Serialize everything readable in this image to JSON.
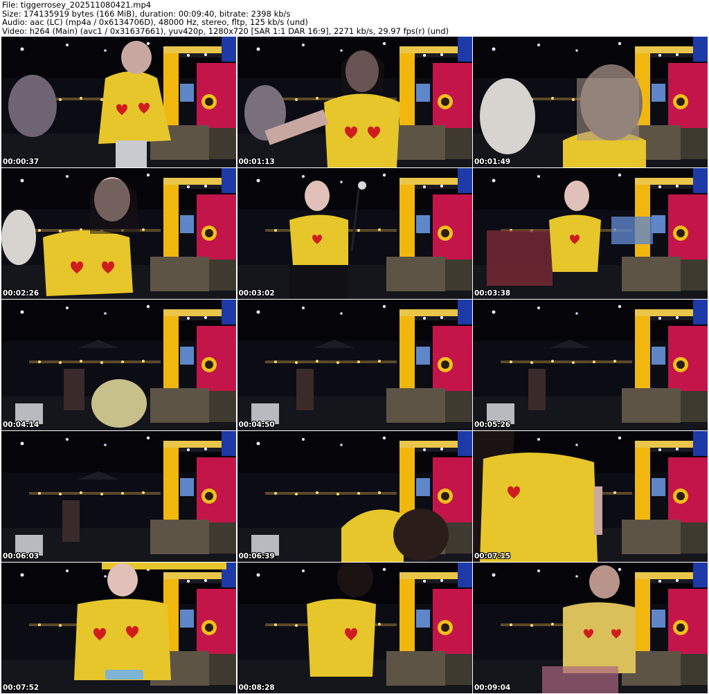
{
  "header": {
    "file_line": "File: tiggerrosey_202511080421.mp4",
    "size_line": "Size: 174135919 bytes (166 MiB), duration: 00:09:40, bitrate: 2398 kb/s",
    "audio_line": "Audio: aac (LC) (mp4a / 0x6134706D), 48000 Hz, stereo, fltp, 125 kb/s (und)",
    "video_line": "Video: h264 (Main) (avc1 / 0x31637661), yuv420p, 1280x720 [SAR 1:1 DAR 16:9], 2271 kb/s, 29.97 fps(r) (und)"
  },
  "thumbnails": [
    {
      "timestamp": "00:00:37"
    },
    {
      "timestamp": "00:01:13"
    },
    {
      "timestamp": "00:01:49"
    },
    {
      "timestamp": "00:02:26"
    },
    {
      "timestamp": "00:03:02"
    },
    {
      "timestamp": "00:03:38"
    },
    {
      "timestamp": "00:04:14"
    },
    {
      "timestamp": "00:04:50"
    },
    {
      "timestamp": "00:05:26"
    },
    {
      "timestamp": "00:06:03"
    },
    {
      "timestamp": "00:06:39"
    },
    {
      "timestamp": "00:07:15"
    },
    {
      "timestamp": "00:07:52"
    },
    {
      "timestamp": "00:08:28"
    },
    {
      "timestamp": "00:09:04"
    }
  ],
  "colors": {
    "background": "#ffffff",
    "text": "#000000",
    "timestamp": "#ffffff",
    "shirt_yellow": "#e6c62a",
    "heart_red": "#d01c1c",
    "booth_yellow": "#f2b70f",
    "booth_magenta": "#c4154a",
    "scene_dark": "#0b0c14"
  }
}
